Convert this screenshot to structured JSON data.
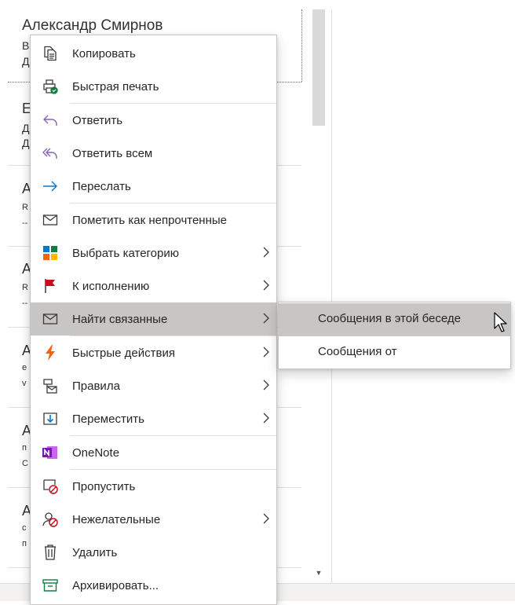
{
  "mail_list": {
    "first_sender": "Александр Смирнов",
    "peeks": [
      "В",
      "Д",
      "Е",
      "Д",
      "Д",
      "А",
      "R",
      "--",
      "А",
      "R",
      "--",
      "А",
      "е",
      "v",
      "А",
      "п",
      "С",
      "А",
      "с",
      "п"
    ]
  },
  "context_menu": {
    "items": [
      {
        "label": "Копировать",
        "icon": "copy-icon"
      },
      {
        "label": "Быстрая печать",
        "icon": "quick-print-icon"
      },
      {
        "label": "Ответить",
        "icon": "reply-icon"
      },
      {
        "label": "Ответить всем",
        "icon": "reply-all-icon"
      },
      {
        "label": "Переслать",
        "icon": "forward-icon"
      },
      {
        "label": "Пометить как непрочтенные",
        "icon": "mail-unread-icon"
      },
      {
        "label": "Выбрать категорию",
        "icon": "category-icon"
      },
      {
        "label": "К исполнению",
        "icon": "flag-icon"
      },
      {
        "label": "Найти связанные",
        "icon": "find-related-icon"
      },
      {
        "label": "Быстрые действия",
        "icon": "quick-steps-icon"
      },
      {
        "label": "Правила",
        "icon": "rules-icon"
      },
      {
        "label": "Переместить",
        "icon": "move-icon"
      },
      {
        "label": "OneNote",
        "icon": "onenote-icon"
      },
      {
        "label": "Пропустить",
        "icon": "ignore-icon"
      },
      {
        "label": "Нежелательные",
        "icon": "junk-icon"
      },
      {
        "label": "Удалить",
        "icon": "delete-icon"
      },
      {
        "label": "Архивировать...",
        "icon": "archive-icon"
      }
    ]
  },
  "submenu": {
    "items": [
      {
        "label": "Сообщения в этой беседе"
      },
      {
        "label": "Сообщения от"
      }
    ]
  },
  "colors": {
    "highlight": "#c8c6c4",
    "reply_purple": "#8764b8",
    "forward_blue": "#0078d4",
    "flag_red": "#c50f1f",
    "quick_steps_orange": "#f7630c",
    "onenote_purple": "#7719aa",
    "archive_green": "#107c41"
  }
}
